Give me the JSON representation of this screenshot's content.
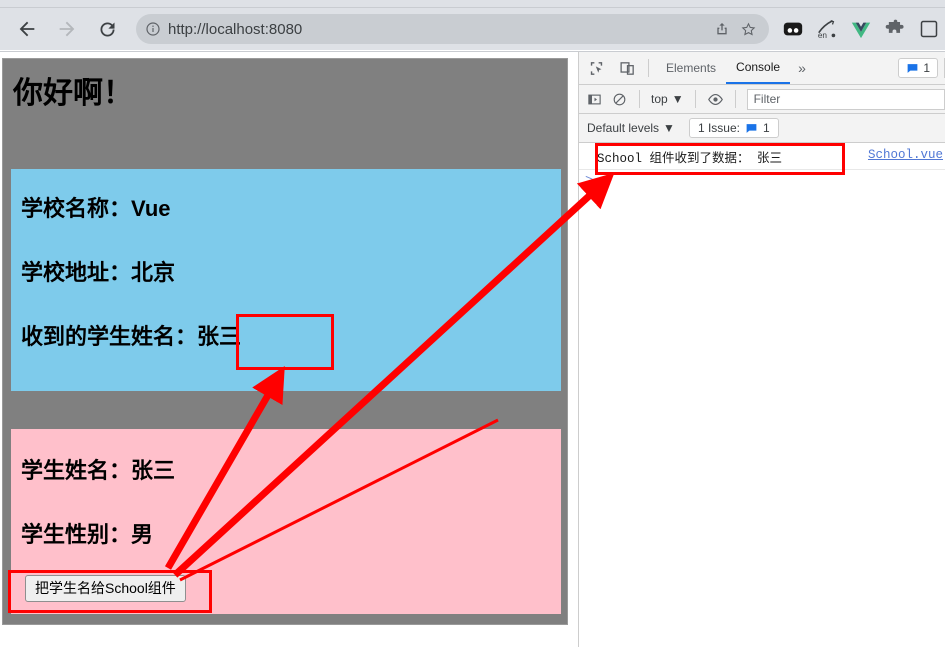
{
  "browser": {
    "back_label": "Back",
    "forward_label": "Forward",
    "reload_label": "Reload",
    "url": "http://localhost:8080",
    "site_info_icon": "info-circle-icon",
    "share_icon": "share-icon",
    "bookmark_icon": "star-icon",
    "extensions": [
      {
        "name": "extension-dark-square-icon",
        "label": ""
      },
      {
        "name": "translate-extension-icon",
        "label": "en"
      },
      {
        "name": "vue-devtools-icon",
        "label": ""
      },
      {
        "name": "puzzle-extensions-icon",
        "label": ""
      },
      {
        "name": "browser-profile-icon",
        "label": ""
      }
    ]
  },
  "page": {
    "heading": "你好啊！",
    "school": {
      "name_row": "学校名称：Vue",
      "address_row": "学校地址：北京",
      "received_row_label": "收到的学生姓名：",
      "received_row_value": "张三"
    },
    "student": {
      "name_row": "学生姓名：张三",
      "gender_row": "学生性别：男",
      "button_label": "把学生名给School组件"
    },
    "colors": {
      "container": "#808080",
      "school_panel": "#7ecbeb",
      "student_panel": "#ffc0cb",
      "annotation": "#ff0000"
    }
  },
  "devtools": {
    "inspect_icon": "inspect-element-icon",
    "device_toolbar_icon": "device-toolbar-icon",
    "tabs": [
      {
        "label": "Elements",
        "active": false
      },
      {
        "label": "Console",
        "active": true
      }
    ],
    "more_tabs_label": "»",
    "issues_chip": {
      "icon": "issue-message-icon",
      "count": "1"
    },
    "toolbar": {
      "sidebar_icon": "console-sidebar-icon",
      "clear_icon": "clear-console-icon",
      "context_label": "top",
      "context_caret": "▼",
      "eye_icon": "live-expression-eye-icon",
      "filter_placeholder": "Filter"
    },
    "levels": {
      "label": "Default levels",
      "caret": "▼",
      "issues_label": "1 Issue:",
      "issues_icon": "issue-message-icon",
      "issues_count": "1"
    },
    "console_message": {
      "text": "School 组件收到了数据： 张三",
      "source": "School.vue"
    },
    "prompt_caret": ">"
  },
  "annotations": {
    "received_name_box": "红框-收到的学生姓名",
    "send_button_box": "红框-按钮",
    "console_message_box": "红框-控制台输出",
    "arrow_button_to_received": "箭头-按钮指向收到的姓名",
    "arrow_button_to_console": "箭头-按钮指向控制台"
  }
}
